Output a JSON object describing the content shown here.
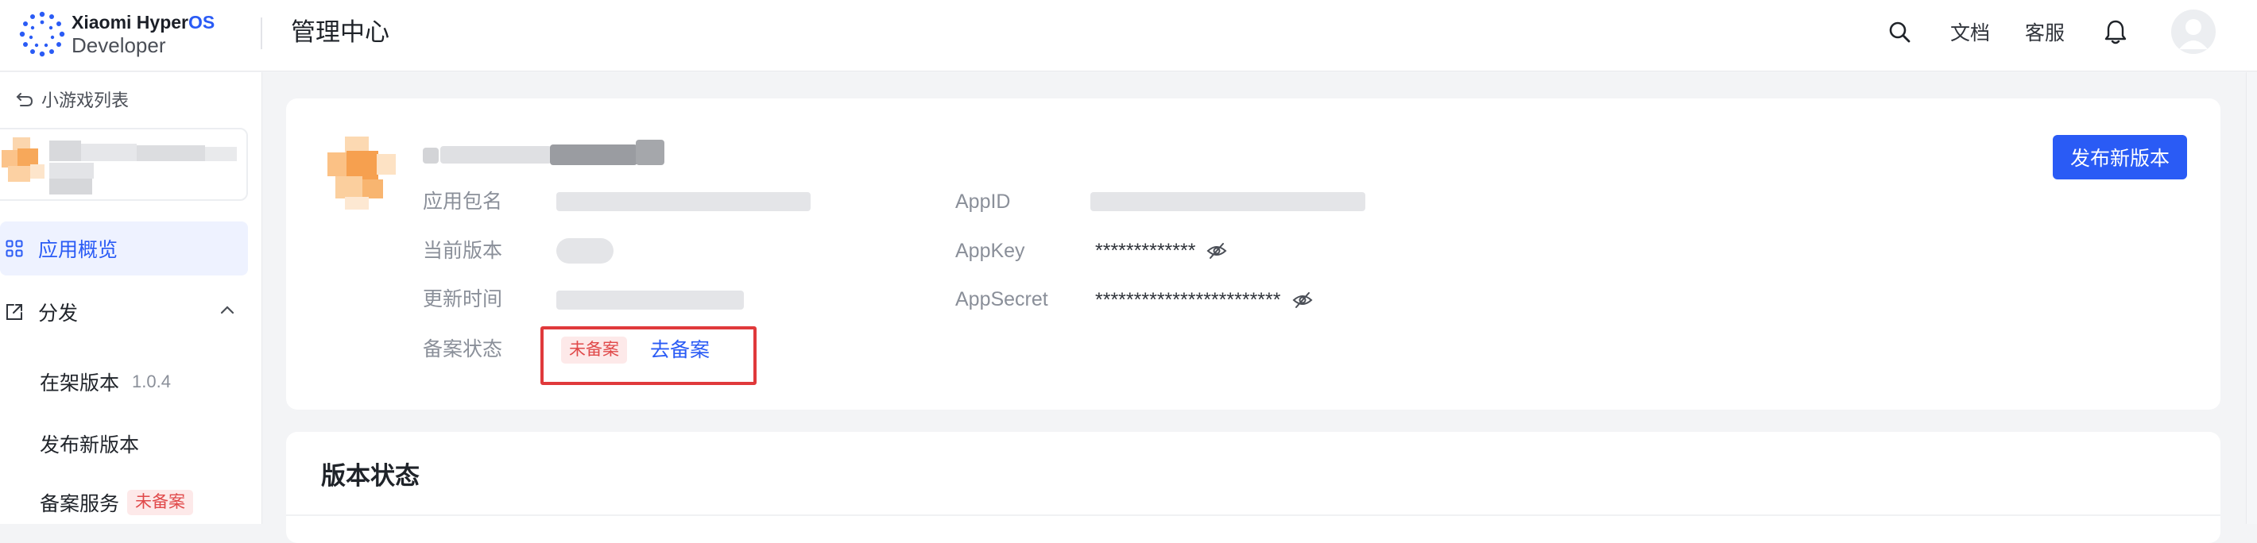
{
  "header": {
    "brand_line1_prefix": "Xiaomi Hyper",
    "brand_line1_accent": "OS",
    "brand_line2": "Developer",
    "portal_title": "管理中心",
    "docs_label": "文档",
    "support_label": "客服",
    "icons": [
      "search-icon",
      "bell-icon",
      "user-avatar-icon"
    ]
  },
  "sidebar": {
    "back_label": "小游戏列表",
    "menu": {
      "overview_label": "应用概览",
      "distribute_label": "分发",
      "live_version_label": "在架版本",
      "live_version_value": "1.0.4",
      "publish_label": "发布新版本",
      "filing_service_label": "备案服务",
      "filing_service_badge": "未备案"
    }
  },
  "app_info": {
    "labels": {
      "package": "应用包名",
      "current_version": "当前版本",
      "update_time": "更新时间",
      "filing_status": "备案状态",
      "app_id": "AppID",
      "app_key": "AppKey",
      "app_secret": "AppSecret"
    },
    "app_key_masked": "*************",
    "app_secret_masked": "************************",
    "filing_badge": "未备案",
    "filing_link": "去备案",
    "publish_button": "发布新版本"
  },
  "version_status": {
    "title": "版本状态"
  },
  "colors": {
    "accent": "#2a5bf5",
    "danger": "#e0494a",
    "highlight_box": "#e0393b"
  }
}
